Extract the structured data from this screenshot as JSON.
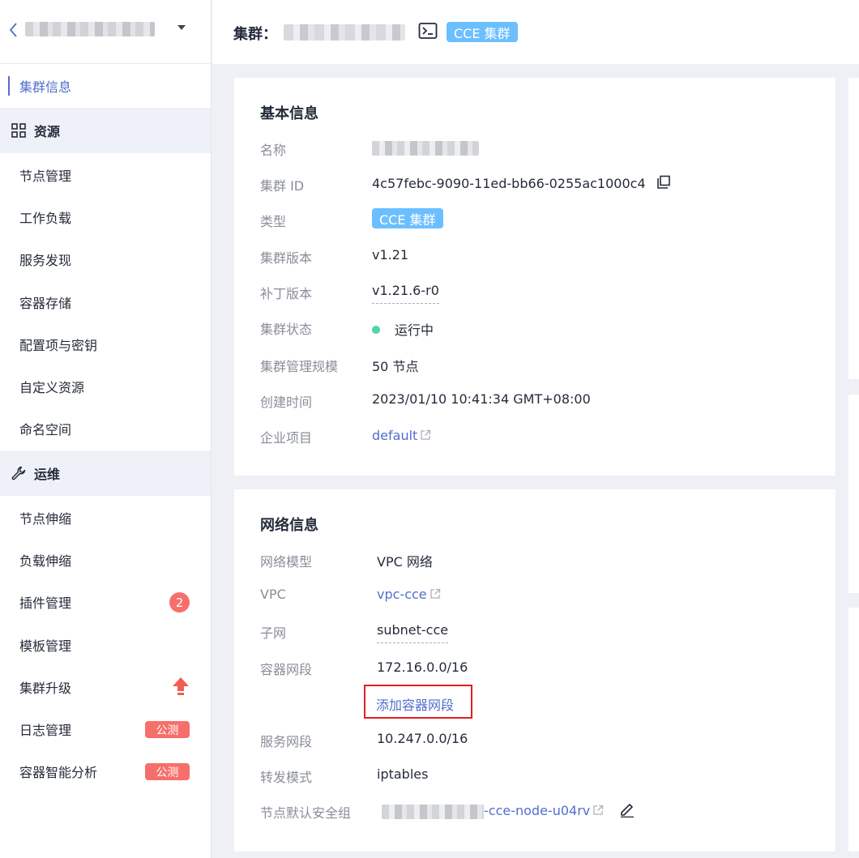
{
  "sidebar": {
    "cluster_name_placeholder": "",
    "items": [
      {
        "label": "集群信息",
        "active": true
      },
      {
        "label": "资源",
        "group": true,
        "icon": "grid-icon"
      },
      {
        "label": "节点管理"
      },
      {
        "label": "工作负载"
      },
      {
        "label": "服务发现"
      },
      {
        "label": "容器存储"
      },
      {
        "label": "配置项与密钥"
      },
      {
        "label": "自定义资源"
      },
      {
        "label": "命名空间"
      },
      {
        "label": "运维",
        "group": true,
        "icon": "wrench-icon"
      },
      {
        "label": "节点伸缩"
      },
      {
        "label": "负载伸缩"
      },
      {
        "label": "插件管理",
        "badge": "2"
      },
      {
        "label": "模板管理"
      },
      {
        "label": "集群升级",
        "icon": "upgrade-arrow-icon"
      },
      {
        "label": "日志管理",
        "tag": "公测"
      },
      {
        "label": "容器智能分析",
        "tag": "公测"
      }
    ]
  },
  "header": {
    "label": "集群：",
    "tag": "CCE 集群"
  },
  "basic_info": {
    "title": "基本信息",
    "rows": {
      "name": {
        "label": "名称"
      },
      "cluster_id": {
        "label": "集群 ID",
        "value": "4c57febc-9090-11ed-bb66-0255ac1000c4"
      },
      "type": {
        "label": "类型",
        "value": "CCE 集群"
      },
      "version": {
        "label": "集群版本",
        "value": "v1.21"
      },
      "patch": {
        "label": "补丁版本",
        "value": "v1.21.6-r0"
      },
      "status": {
        "label": "集群状态",
        "value": "运行中"
      },
      "scale": {
        "label": "集群管理规模",
        "value": "50 节点"
      },
      "created": {
        "label": "创建时间",
        "value": "2023/01/10 10:41:34 GMT+08:00"
      },
      "project": {
        "label": "企业项目",
        "value": "default"
      }
    }
  },
  "network_info": {
    "title": "网络信息",
    "rows": {
      "model": {
        "label": "网络模型",
        "value": "VPC 网络"
      },
      "vpc": {
        "label": "VPC",
        "value": "vpc-cce"
      },
      "subnet": {
        "label": "子网",
        "value": "subnet-cce"
      },
      "container_cidr": {
        "label": "容器网段",
        "value": "172.16.0.0/16"
      },
      "add_cidr": {
        "value": "添加容器网段"
      },
      "service_cidr": {
        "label": "服务网段",
        "value": "10.247.0.0/16"
      },
      "forward": {
        "label": "转发模式",
        "value": "iptables"
      },
      "security_group": {
        "label": "节点默认安全组",
        "value": "-cce-node-u04rv"
      }
    }
  },
  "colors": {
    "accent": "#526ecc",
    "tag_blue": "#6cbfff",
    "badge_red": "#f66f6a",
    "status_green": "#50d4ab",
    "highlight_red": "#e02020"
  }
}
